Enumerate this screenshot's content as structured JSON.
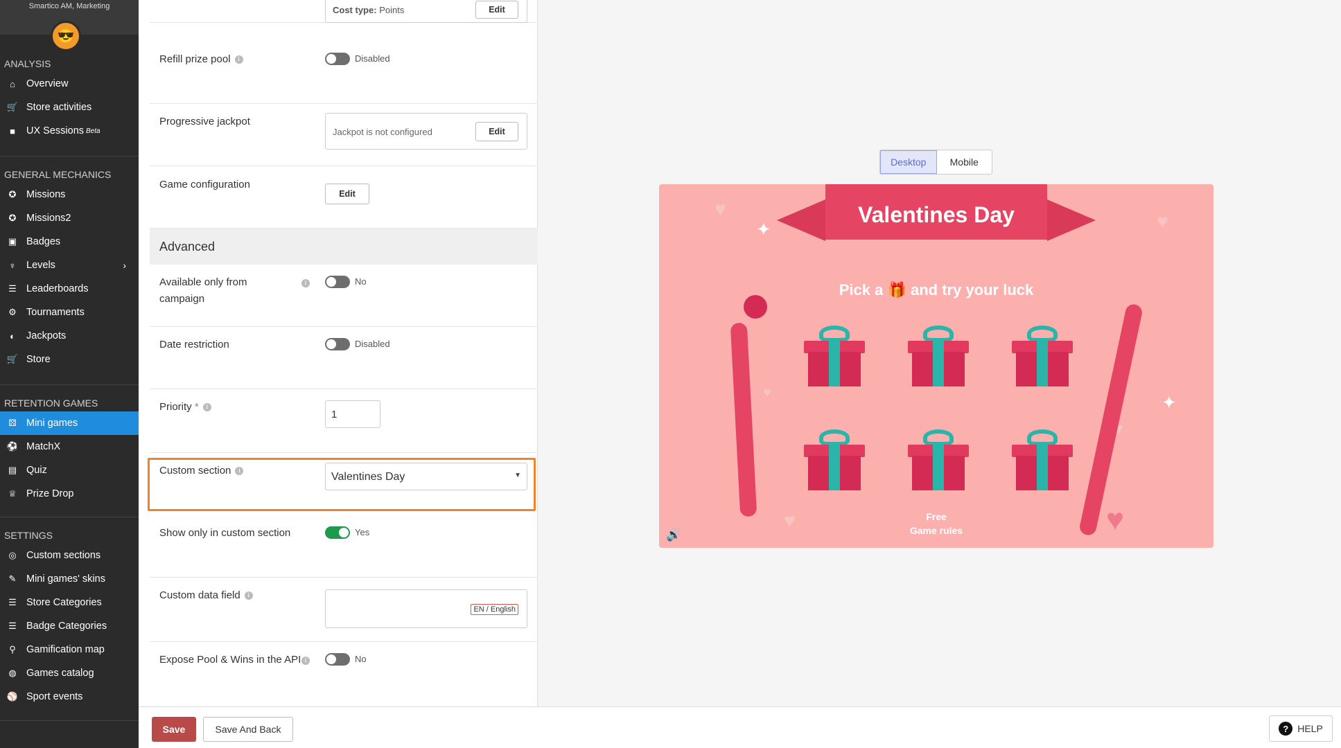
{
  "sidebar": {
    "account_name": "Smartico AM, Marketing",
    "sections": {
      "analysis": "ANALYSIS",
      "general": "GENERAL MECHANICS",
      "retention": "RETENTION GAMES",
      "settings": "SETTINGS"
    },
    "analysis_items": [
      "Overview",
      "Store activities",
      "UX Sessions"
    ],
    "ux_badge": "Beta",
    "general_items": [
      "Missions",
      "Missions2",
      "Badges",
      "Levels",
      "Leaderboards",
      "Tournaments",
      "Jackpots",
      "Store"
    ],
    "retention_items": [
      "Mini games",
      "MatchX",
      "Quiz",
      "Prize Drop"
    ],
    "settings_items": [
      "Custom sections",
      "Mini games' skins",
      "Store Categories",
      "Badge Categories",
      "Gamification map",
      "Games catalog",
      "Sport events"
    ]
  },
  "form": {
    "cost_type_label": "Cost type:",
    "cost_type_value": "Points",
    "edit_label": "Edit",
    "refill_label": "Refill prize pool",
    "refill_state": "Disabled",
    "jackpot_label": "Progressive jackpot",
    "jackpot_text": "Jackpot is not configured",
    "game_config_label": "Game configuration",
    "advanced_title": "Advanced",
    "campaign_label": "Available only from campaign",
    "campaign_state": "No",
    "date_label": "Date restriction",
    "date_state": "Disabled",
    "priority_label": "Priority",
    "priority_required": "*",
    "priority_value": "1",
    "custom_section_label": "Custom section",
    "custom_section_value": "Valentines Day",
    "show_only_label": "Show only in custom section",
    "show_only_state": "Yes",
    "custom_data_label": "Custom data field",
    "lang_badge": "EN / English",
    "expose_label": "Expose Pool & Wins in the API",
    "expose_state": "No"
  },
  "preview": {
    "tabs": [
      "Desktop",
      "Mobile"
    ],
    "active_tab": "Desktop",
    "banner_title": "Valentines Day",
    "pick_text_left": "Pick a",
    "pick_text_right": "and try your luck",
    "free_text": "Free",
    "rules_text": "Game rules"
  },
  "bottom": {
    "save": "Save",
    "save_back": "Save And Back",
    "help": "HELP"
  },
  "colors": {
    "sidebar_bg": "#2b2b2b",
    "active_nav": "#1f8ddb",
    "highlight_border": "#f0822f",
    "toggle_on": "#1f9a4d",
    "save_btn": "#b84a4a",
    "preview_bg": "#fbb0ae"
  }
}
